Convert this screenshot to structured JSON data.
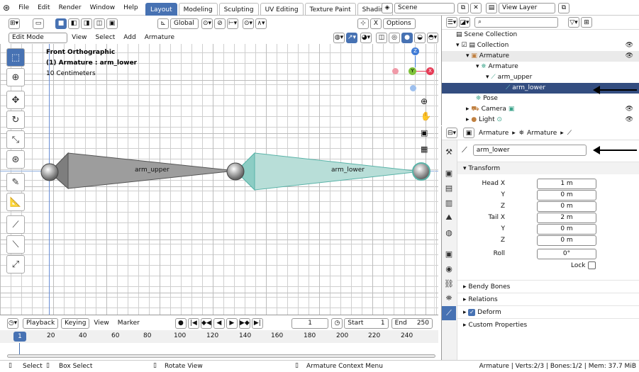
{
  "topbar": {
    "menus": [
      "File",
      "Edit",
      "Render",
      "Window",
      "Help"
    ],
    "workspaces": [
      "Layout",
      "Modeling",
      "Sculpting",
      "UV Editing",
      "Texture Paint",
      "Shading"
    ],
    "scene": "Scene",
    "view_layer": "View Layer"
  },
  "header": {
    "mode": "Edit Mode",
    "menus": [
      "View",
      "Select",
      "Add",
      "Armature"
    ],
    "transform_orientation": "Global",
    "options": "Options"
  },
  "viewport": {
    "view_name": "Front Orthographic",
    "object_info": "(1) Armature : arm_lower",
    "scale": "10 Centimeters",
    "bones": [
      {
        "name": "arm_upper",
        "selected": false
      },
      {
        "name": "arm_lower",
        "selected": true
      }
    ],
    "gizmo": {
      "z": "Z",
      "y": "Y",
      "x": "X"
    }
  },
  "timeline": {
    "playback": "Playback",
    "keying": "Keying",
    "view": "View",
    "marker": "Marker",
    "current_frame": "1",
    "start_label": "Start",
    "start": "1",
    "end_label": "End",
    "end": "250",
    "ruler": [
      "1",
      "20",
      "40",
      "60",
      "80",
      "100",
      "120",
      "140",
      "160",
      "180",
      "200",
      "220",
      "240"
    ]
  },
  "statusbar": {
    "select": "Select",
    "box_select": "Box Select",
    "rotate_view": "Rotate View",
    "context_menu": "Armature Context Menu",
    "stats": "Armature | Verts:2/3 | Bones:1/2 | Mem: 37.7 MiB"
  },
  "outliner": {
    "rows": [
      {
        "label": "Scene Collection",
        "indent": 0
      },
      {
        "label": "Collection",
        "indent": 1
      },
      {
        "label": "Armature",
        "indent": 2
      },
      {
        "label": "Armature",
        "indent": 3
      },
      {
        "label": "arm_upper",
        "indent": 4
      },
      {
        "label": "arm_lower",
        "indent": 5
      },
      {
        "label": "Pose",
        "indent": 3
      },
      {
        "label": "Camera",
        "indent": 2
      },
      {
        "label": "Light",
        "indent": 2
      }
    ]
  },
  "properties": {
    "breadcrumb": [
      "Armature",
      "Armature"
    ],
    "bone_name": "arm_lower",
    "transform_title": "Transform",
    "head_x_label": "Head X",
    "head_x": "1 m",
    "head_y_label": "Y",
    "head_y": "0 m",
    "head_z_label": "Z",
    "head_z": "0 m",
    "tail_x_label": "Tail X",
    "tail_x": "2 m",
    "tail_y_label": "Y",
    "tail_y": "0 m",
    "tail_z_label": "Z",
    "tail_z": "0 m",
    "roll_label": "Roll",
    "roll": "0°",
    "lock_label": "Lock",
    "sections": [
      "Bendy Bones",
      "Relations",
      "Deform",
      "Custom Properties"
    ]
  },
  "colors": {
    "accent": "#4772b3",
    "selected_bone": "#6ec8c0",
    "outliner_selection": "#334d80"
  }
}
